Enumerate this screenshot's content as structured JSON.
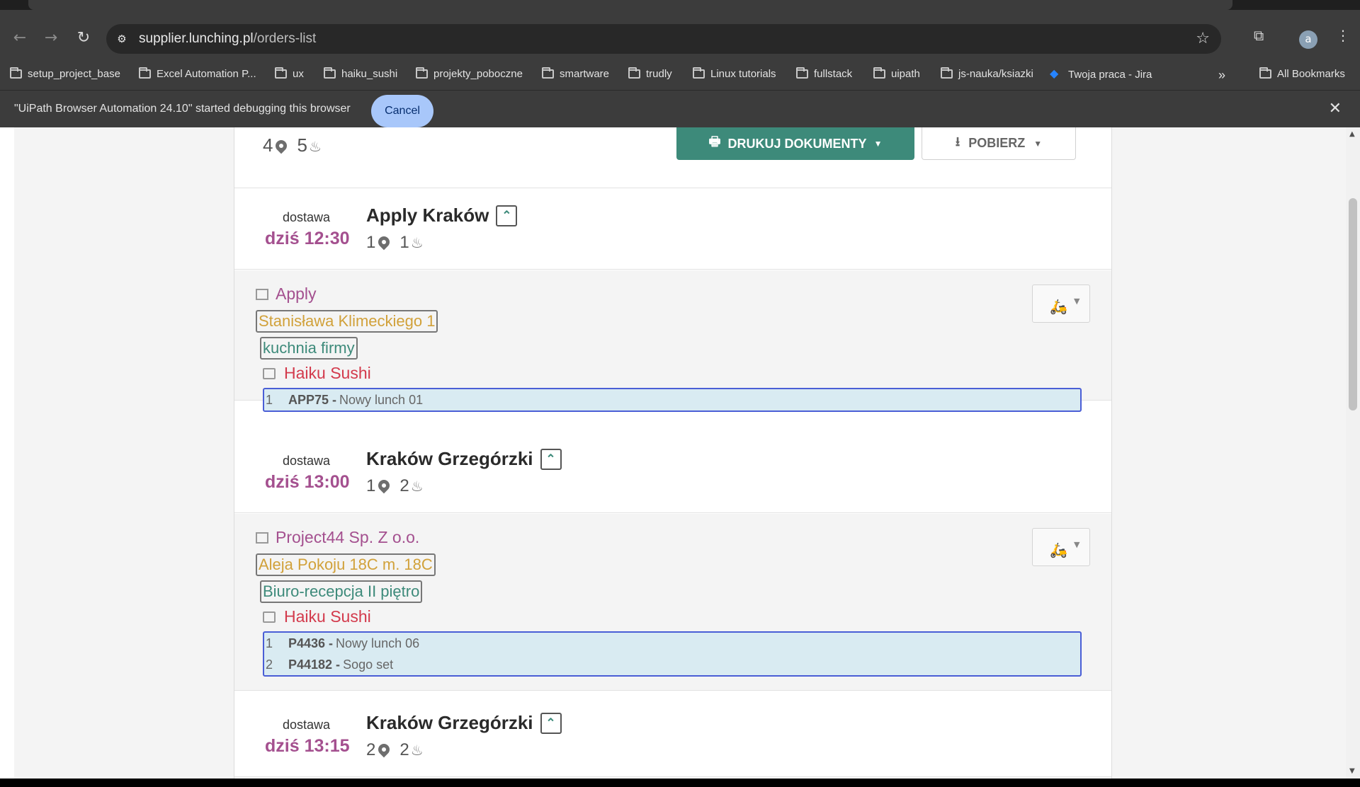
{
  "browser": {
    "url_domain": "supplier.lunching.pl",
    "url_path": "/orders-list",
    "bookmarks": [
      "setup_project_base",
      "Excel Automation P...",
      "ux",
      "haiku_sushi",
      "projekty_poboczne",
      "smartware",
      "trudly",
      "Linux tutorials",
      "fullstack",
      "uipath",
      "js-nauka/ksiazki",
      "Twoja praca - Jira"
    ],
    "all_bookmarks": "All Bookmarks",
    "avatar_letter": "a",
    "infobar_message": "\"UiPath Browser Automation 24.10\" started debugging this browser",
    "infobar_cancel": "Cancel"
  },
  "summary": {
    "locations": "4",
    "meals": "5",
    "print_label": "DRUKUJ DOKUMENTY",
    "download_label": "POBIERZ"
  },
  "deliveries": [
    {
      "label": "dostawa",
      "time": "dziś 12:30",
      "title": "Apply Kraków",
      "locations": "1",
      "meals": "1",
      "company": "Apply",
      "address": "Stanisława Klimeckiego 1",
      "place": "kuchnia firmy",
      "restaurant": "Haiku Sushi",
      "items": [
        {
          "num": "1",
          "code": "APP75 -",
          "name": "Nowy lunch 01"
        }
      ]
    },
    {
      "label": "dostawa",
      "time": "dziś 13:00",
      "title": "Kraków Grzegórzki",
      "locations": "1",
      "meals": "2",
      "company": "Project44 Sp. Z o.o.",
      "address": "Aleja Pokoju 18C m. 18C",
      "place": "Biuro-recepcja II piętro",
      "restaurant": "Haiku Sushi",
      "items": [
        {
          "num": "1",
          "code": "P4436 -",
          "name": "Nowy lunch 06"
        },
        {
          "num": "2",
          "code": "P44182 -",
          "name": "Sogo set"
        }
      ]
    },
    {
      "label": "dostawa",
      "time": "dziś 13:15",
      "title": "Kraków Grzegórzki",
      "locations": "2",
      "meals": "2"
    }
  ]
}
